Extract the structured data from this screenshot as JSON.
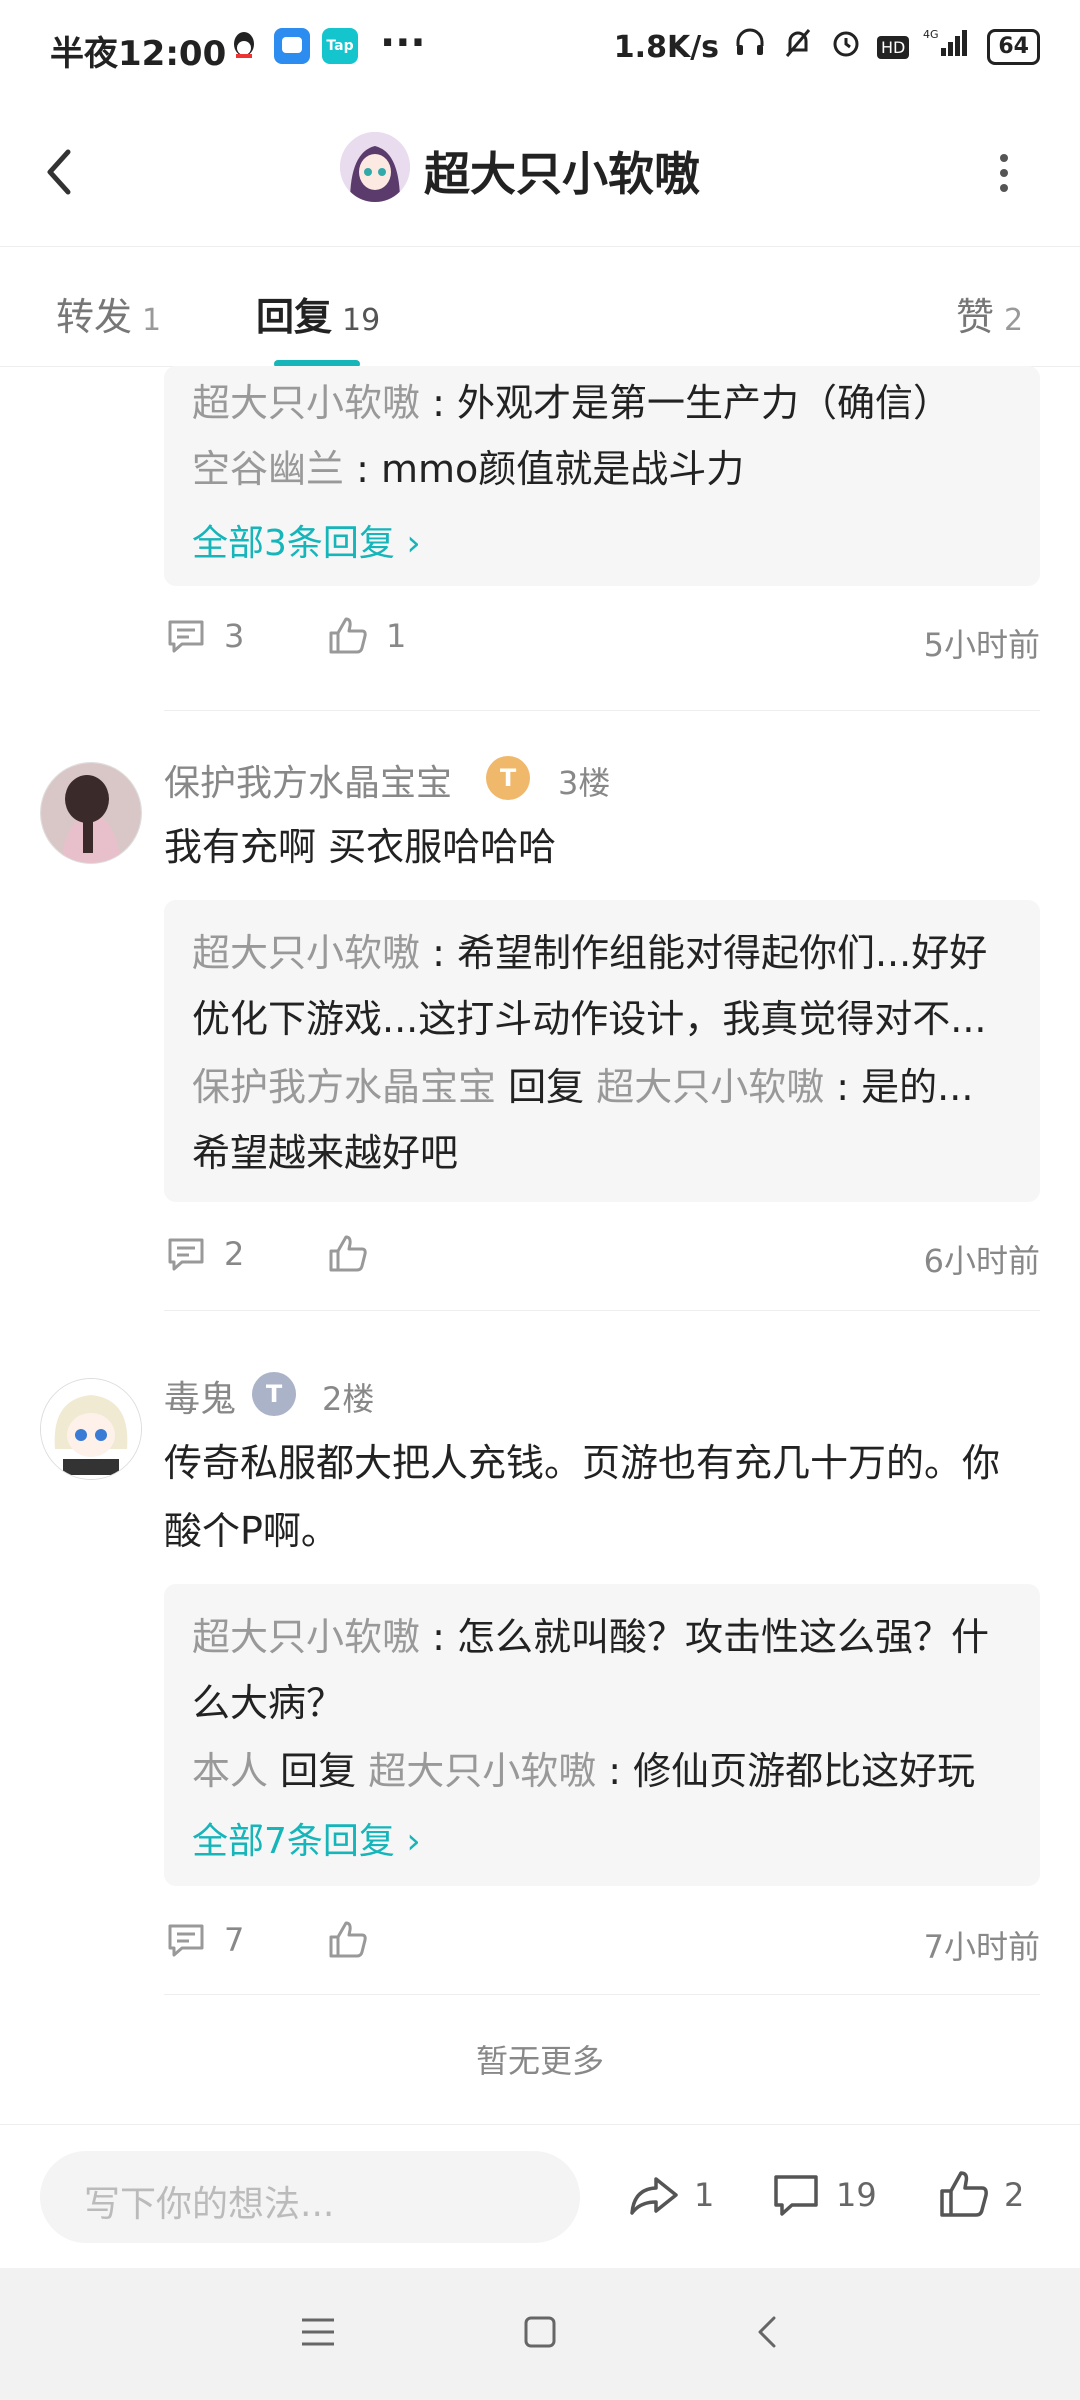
{
  "status_bar": {
    "time": "半夜12:00",
    "app_icons": [
      "qq-icon",
      "chat-app-icon",
      "taptap-icon"
    ],
    "more": "···",
    "net_speed": "1.8K/s",
    "battery": "64"
  },
  "header": {
    "title": "超大只小软嗷"
  },
  "tabs": [
    {
      "label": "转发",
      "count": "1"
    },
    {
      "label": "回复",
      "count": "19"
    },
    {
      "label": "赞",
      "count": "2"
    }
  ],
  "comments": [
    {
      "replies": [
        {
          "author": "超大只小软嗷",
          "text": " : 外观才是第一生产力（确信）"
        },
        {
          "author": "空谷幽兰",
          "text": " : mmo颜值就是战斗力"
        }
      ],
      "more_link": "全部3条回复 ›",
      "reply_count": "3",
      "like_count": "1",
      "time": "5小时前"
    },
    {
      "name": "保护我方水晶宝宝",
      "badge": "T",
      "floor": "3楼",
      "content": "我有充啊 买衣服哈哈哈",
      "replies": [
        {
          "author": "超大只小软嗷",
          "text": " : 希望制作组能对得起你们...好好"
        },
        {
          "author": "",
          "text": "优化下游戏...这打斗动作设计，我真觉得对不..."
        },
        {
          "author": "保护我方水晶宝宝",
          "mid": " 回复 ",
          "author2": "超大只小软嗷",
          "text": " : 是的..."
        },
        {
          "author": "",
          "text": "希望越来越好吧"
        }
      ],
      "reply_count": "2",
      "time": "6小时前"
    },
    {
      "name": "毒鬼",
      "badge": "T",
      "floor": "2楼",
      "content_line1": "传奇私服都大把人充钱。页游也有充几十万的。你",
      "content_line2": "酸个P啊。",
      "replies": [
        {
          "author": "超大只小软嗷",
          "text": " : 怎么就叫酸？攻击性这么强？什"
        },
        {
          "author": "",
          "text": "么大病？"
        },
        {
          "author": "本人",
          "mid": " 回复 ",
          "author2": "超大只小软嗷",
          "text": " : 修仙页游都比这好玩"
        }
      ],
      "more_link": "全部7条回复 ›",
      "reply_count": "7",
      "time": "7小时前"
    }
  ],
  "no_more": "暂无更多",
  "bottom_bar": {
    "placeholder": "写下你的想法...",
    "share_count": "1",
    "comment_count": "19",
    "like_count": "2"
  },
  "colors": {
    "accent": "#15b5b9",
    "muted": "#888888",
    "reply_bg": "#f6f6f6"
  }
}
